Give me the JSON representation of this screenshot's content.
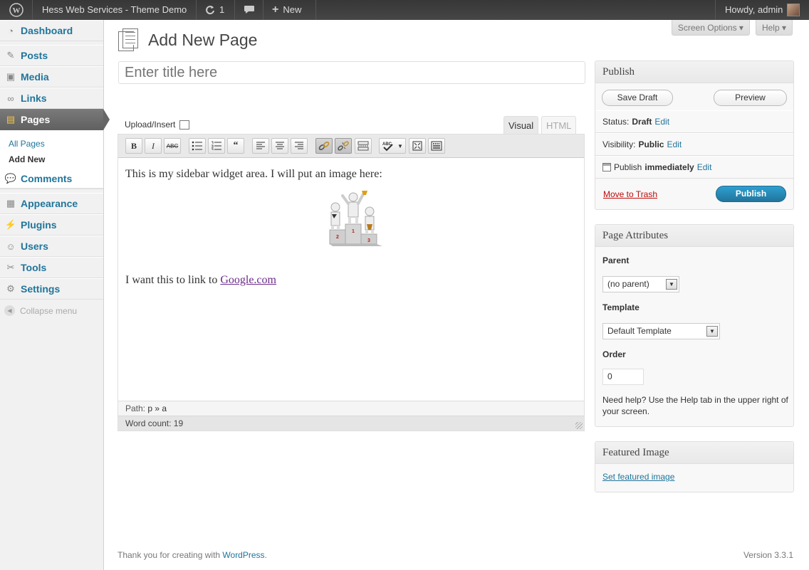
{
  "adminbar": {
    "site_name": "Hess Web Services - Theme Demo",
    "updates_count": "1",
    "new_label": "New",
    "howdy": "Howdy, admin"
  },
  "sidebar": {
    "items": [
      {
        "label": "Dashboard"
      },
      {
        "label": "Posts"
      },
      {
        "label": "Media"
      },
      {
        "label": "Links"
      },
      {
        "label": "Pages"
      },
      {
        "label": "Comments"
      },
      {
        "label": "Appearance"
      },
      {
        "label": "Plugins"
      },
      {
        "label": "Users"
      },
      {
        "label": "Tools"
      },
      {
        "label": "Settings"
      }
    ],
    "submenu": {
      "all_pages": "All Pages",
      "add_new": "Add New"
    },
    "collapse": "Collapse menu"
  },
  "header": {
    "screen_options": "Screen Options",
    "help": "Help",
    "page_title": "Add New Page"
  },
  "editor": {
    "title_placeholder": "Enter title here",
    "upload_insert": "Upload/Insert",
    "tab_visual": "Visual",
    "tab_html": "HTML",
    "paragraph1": "This is my sidebar widget area.  I will put an image here:",
    "paragraph2_prefix": "I want this to link to ",
    "link_text": "Google.com",
    "path_label": "Path:",
    "path_value": "p » a",
    "word_count": "Word count: 19",
    "podium_labels": [
      "1",
      "2",
      "3"
    ]
  },
  "publish": {
    "title": "Publish",
    "save_draft": "Save Draft",
    "preview": "Preview",
    "status_label": "Status:",
    "status_value": "Draft",
    "visibility_label": "Visibility:",
    "visibility_value": "Public",
    "publish_label": "Publish",
    "publish_value": "immediately",
    "edit": "Edit",
    "move_to_trash": "Move to Trash",
    "publish_button": "Publish"
  },
  "page_attributes": {
    "title": "Page Attributes",
    "parent_label": "Parent",
    "parent_value": "(no parent)",
    "template_label": "Template",
    "template_value": "Default Template",
    "order_label": "Order",
    "order_value": "0",
    "help_text": "Need help? Use the Help tab in the upper right of your screen."
  },
  "featured_image": {
    "title": "Featured Image",
    "link": "Set featured image"
  },
  "footer": {
    "thanks_prefix": "Thank you for creating with ",
    "wordpress_link": "WordPress",
    "thanks_suffix": ".",
    "version": "Version 3.3.1"
  },
  "colors": {
    "accent": "#21759b",
    "admin_bar": "#464646",
    "trash": "#bc0b0b",
    "visited_link": "#6b2c8a"
  }
}
